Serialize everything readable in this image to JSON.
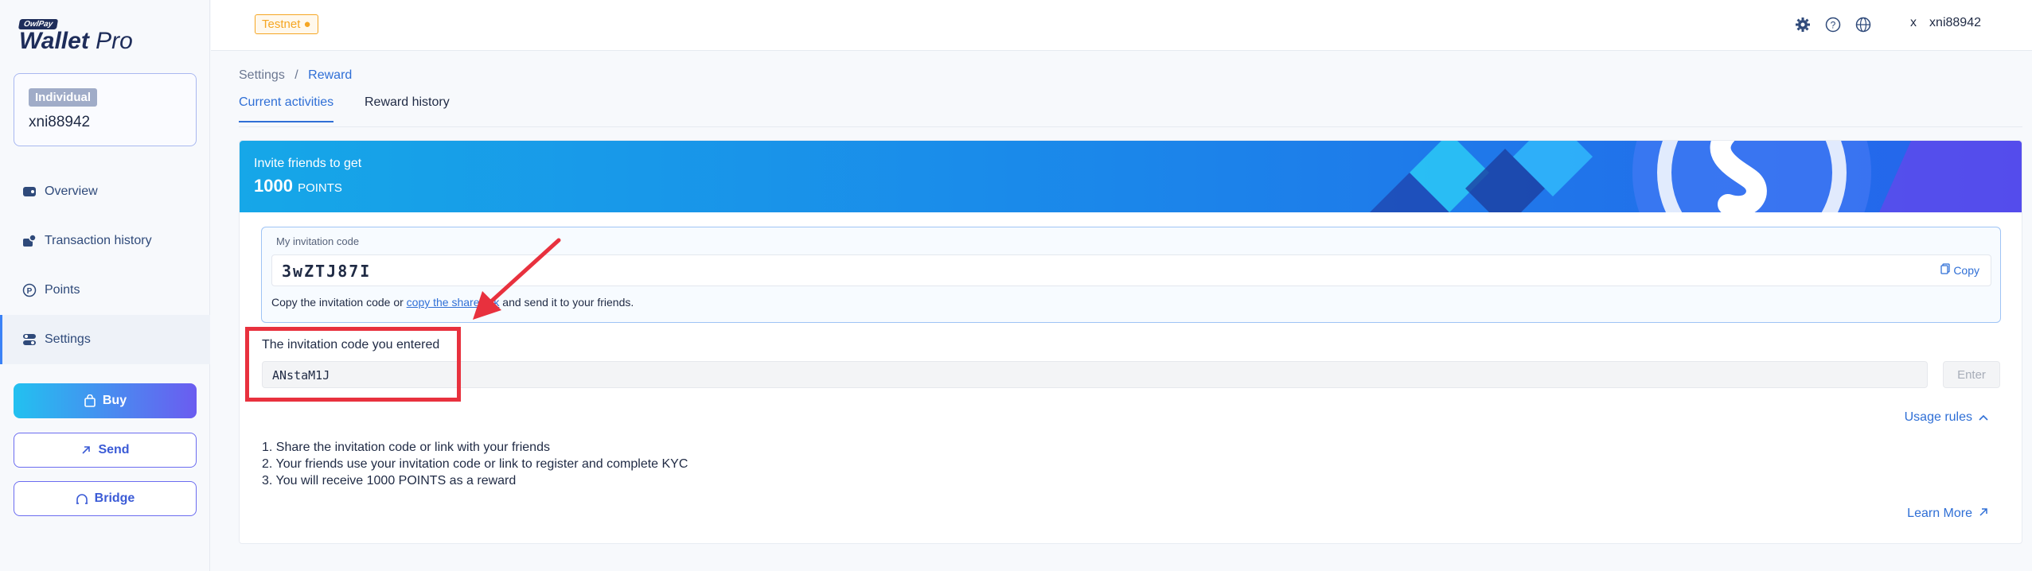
{
  "brand": {
    "badge": "OwlPay",
    "name": "Wallet",
    "suffix": "Pro"
  },
  "account": {
    "type": "Individual",
    "username": "xni88942"
  },
  "nav": [
    {
      "label": "Overview",
      "icon": "wallet-icon"
    },
    {
      "label": "Transaction history",
      "icon": "history-icon"
    },
    {
      "label": "Points",
      "icon": "points-icon"
    },
    {
      "label": "Settings",
      "icon": "settings-toggle-icon",
      "active": true
    }
  ],
  "actions": {
    "buy": "Buy",
    "send": "Send",
    "bridge": "Bridge"
  },
  "topbar": {
    "network": "Testnet",
    "user_initial": "x",
    "username": "xni88942"
  },
  "breadcrumb": {
    "root": "Settings",
    "separator": "/",
    "current": "Reward"
  },
  "tabs": [
    "Current activities",
    "Reward history"
  ],
  "banner": {
    "line1": "Invite friends to get",
    "amount": "1000",
    "unit": "POINTS"
  },
  "invite": {
    "label": "My invitation code",
    "code": "3wZTJ87I",
    "copy_label": "Copy",
    "hint_before": "Copy the invitation code or ",
    "hint_link": "copy the share link",
    "hint_after": " and send it to your friends."
  },
  "entered": {
    "label": "The invitation code you entered",
    "value": "ANstaM1J",
    "button": "Enter"
  },
  "usage_rules": {
    "label": "Usage rules",
    "items": [
      "1. Share the invitation code or link with your friends",
      "2. Your friends use your invitation code or link to register and complete KYC",
      "3. You will receive 1000 POINTS as a reward"
    ]
  },
  "learn_more": "Learn More",
  "colors": {
    "accent": "#2f6fd6",
    "highlight": "#e8313e",
    "testnet": "#f5a623"
  }
}
